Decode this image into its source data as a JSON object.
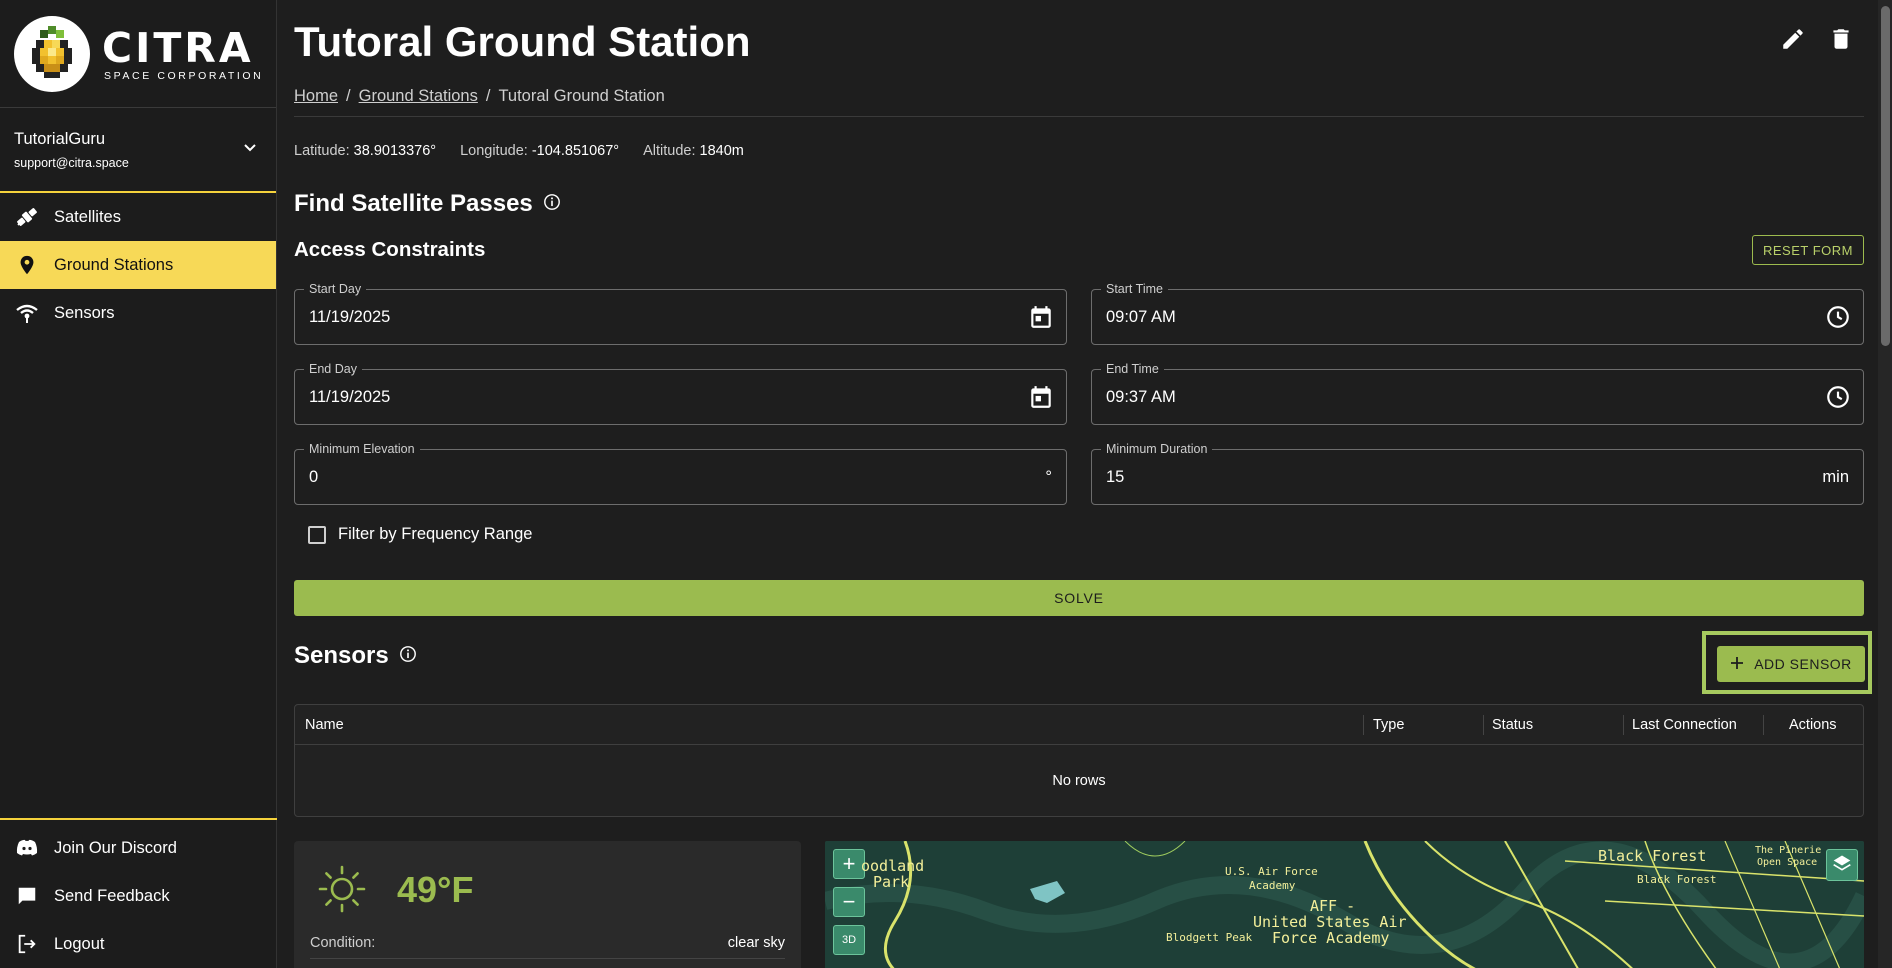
{
  "sidebar": {
    "logo_title": "CITRA",
    "logo_subtitle": "SPACE CORPORATION",
    "user_name": "TutorialGuru",
    "user_email": "support@citra.space",
    "nav": [
      {
        "label": "Satellites",
        "icon": "satellite-icon",
        "active": false
      },
      {
        "label": "Ground Stations",
        "icon": "location-pin-icon",
        "active": true
      },
      {
        "label": "Sensors",
        "icon": "antenna-icon",
        "active": false
      }
    ],
    "bottom": [
      {
        "label": "Join Our Discord",
        "icon": "discord-icon"
      },
      {
        "label": "Send Feedback",
        "icon": "chat-icon"
      },
      {
        "label": "Logout",
        "icon": "logout-icon"
      }
    ]
  },
  "header": {
    "title": "Tutoral Ground Station",
    "breadcrumb": [
      "Home",
      "Ground Stations",
      "Tutoral Ground Station"
    ],
    "separator": "/"
  },
  "coords": {
    "latitude_label": "Latitude:",
    "latitude_value": "38.9013376°",
    "longitude_label": "Longitude:",
    "longitude_value": "-104.851067°",
    "altitude_label": "Altitude:",
    "altitude_value": "1840m"
  },
  "passes": {
    "title": "Find Satellite Passes",
    "access_title": "Access Constraints",
    "reset_label": "RESET FORM",
    "start_day_label": "Start Day",
    "start_day_value": "11/19/2025",
    "start_time_label": "Start Time",
    "start_time_value": "09:07 AM",
    "end_day_label": "End Day",
    "end_day_value": "11/19/2025",
    "end_time_label": "End Time",
    "end_time_value": "09:37 AM",
    "min_elev_label": "Minimum Elevation",
    "min_elev_value": "0",
    "min_elev_unit": "°",
    "min_dur_label": "Minimum Duration",
    "min_dur_value": "15",
    "min_dur_unit": "min",
    "filter_label": "Filter by Frequency Range",
    "solve_label": "SOLVE"
  },
  "sensors": {
    "title": "Sensors",
    "add_label": "ADD SENSOR",
    "columns": [
      "Name",
      "Type",
      "Status",
      "Last Connection",
      "Actions"
    ],
    "empty_text": "No rows"
  },
  "weather": {
    "temp": "49°F",
    "condition_label": "Condition:",
    "condition_value": "clear sky",
    "icon": "sun-icon"
  },
  "map": {
    "labels": [
      "oodland",
      "Park",
      "U.S. Air Force",
      "Academy",
      "AFF -",
      "United States Air",
      "Force Academy",
      "Blodgett Peak",
      "Black Forest",
      "Black Forest",
      "The Pinerie",
      "Open Space"
    ],
    "zoom_in": "+",
    "zoom_out": "−",
    "mode_label": "3D"
  },
  "colors": {
    "accent": "#9bbb4f",
    "highlight": "#f7d957",
    "background": "#1e1e1e"
  }
}
